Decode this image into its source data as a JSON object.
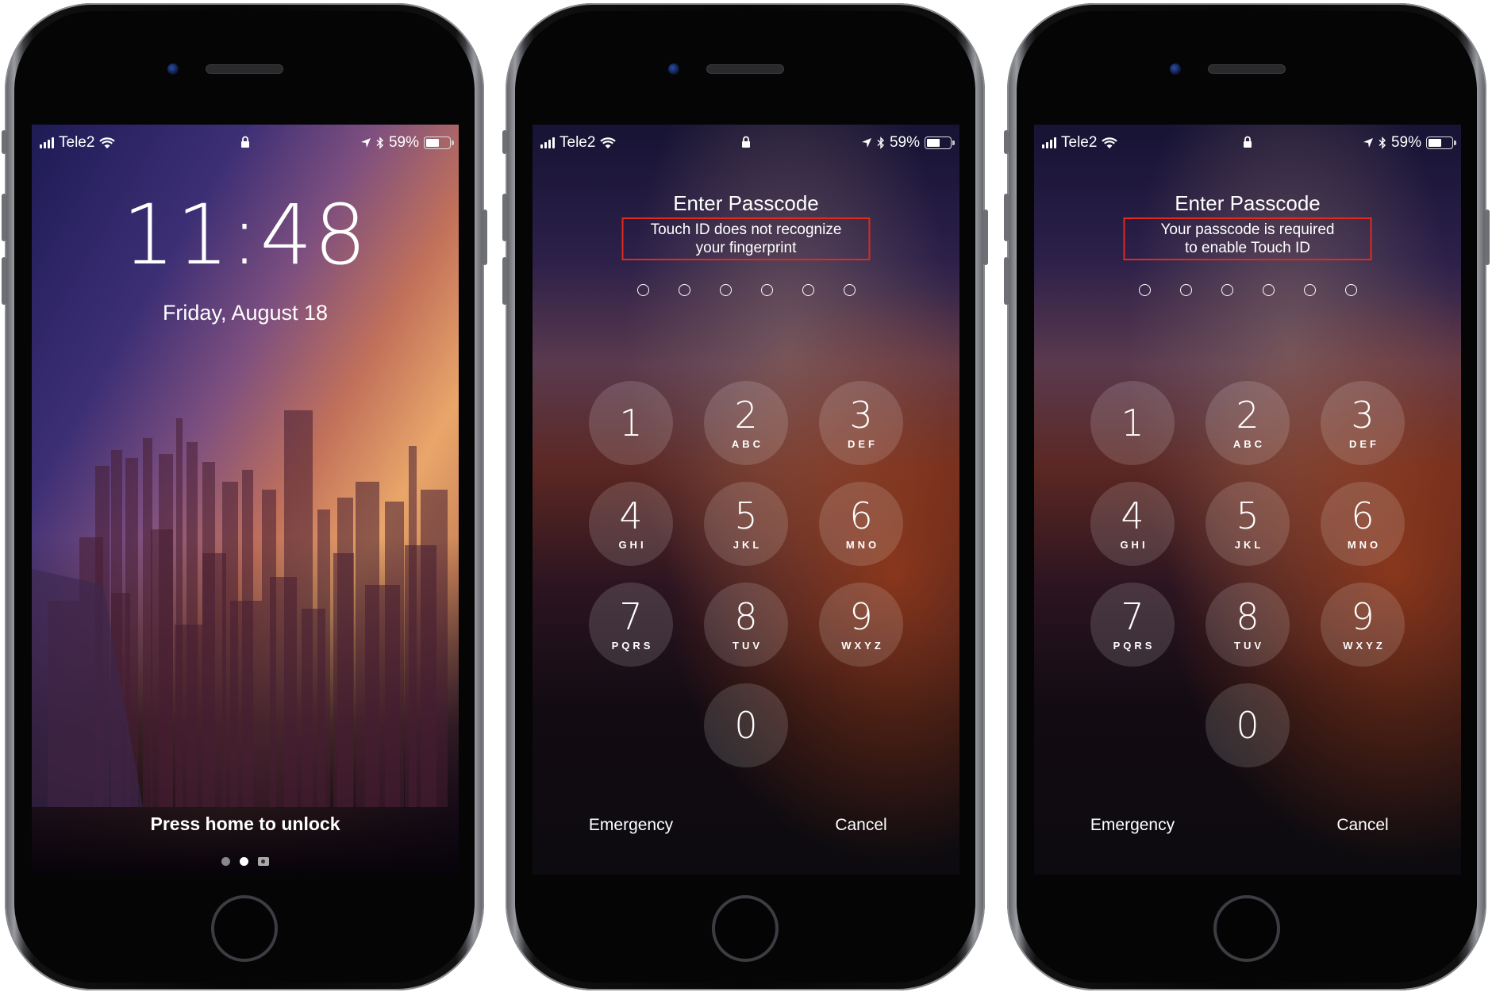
{
  "status_bar": {
    "carrier": "Tele2",
    "battery_text": "59%",
    "battery_level": 0.59,
    "icons": [
      "signal-bars-icon",
      "wifi-icon",
      "lock-icon",
      "location-arrow-icon",
      "bluetooth-icon",
      "battery-icon"
    ]
  },
  "phones": [
    {
      "screen": "lock",
      "time": "11:48",
      "date": "Friday, August 18",
      "unlock_hint": "Press home to unlock",
      "page_indicator": {
        "pages": 2,
        "current": 2,
        "extra": "camera-icon"
      }
    },
    {
      "screen": "passcode",
      "title": "Enter Passcode",
      "message_line1": "Touch ID does not recognize",
      "message_line2": "your fingerprint",
      "passcode_length": 6,
      "emergency": "Emergency",
      "cancel": "Cancel"
    },
    {
      "screen": "passcode",
      "title": "Enter Passcode",
      "message_line1": "Your passcode is required",
      "message_line2": "to enable Touch ID",
      "passcode_length": 6,
      "emergency": "Emergency",
      "cancel": "Cancel"
    }
  ],
  "keypad": [
    {
      "num": "1",
      "letters": ""
    },
    {
      "num": "2",
      "letters": "ABC"
    },
    {
      "num": "3",
      "letters": "DEF"
    },
    {
      "num": "4",
      "letters": "GHI"
    },
    {
      "num": "5",
      "letters": "JKL"
    },
    {
      "num": "6",
      "letters": "MNO"
    },
    {
      "num": "7",
      "letters": "PQRS"
    },
    {
      "num": "8",
      "letters": "TUV"
    },
    {
      "num": "9",
      "letters": "WXYZ"
    },
    {
      "num": "0",
      "letters": ""
    }
  ],
  "colors": {
    "highlight_box": "#e02a1b",
    "text": "#ffffff"
  }
}
